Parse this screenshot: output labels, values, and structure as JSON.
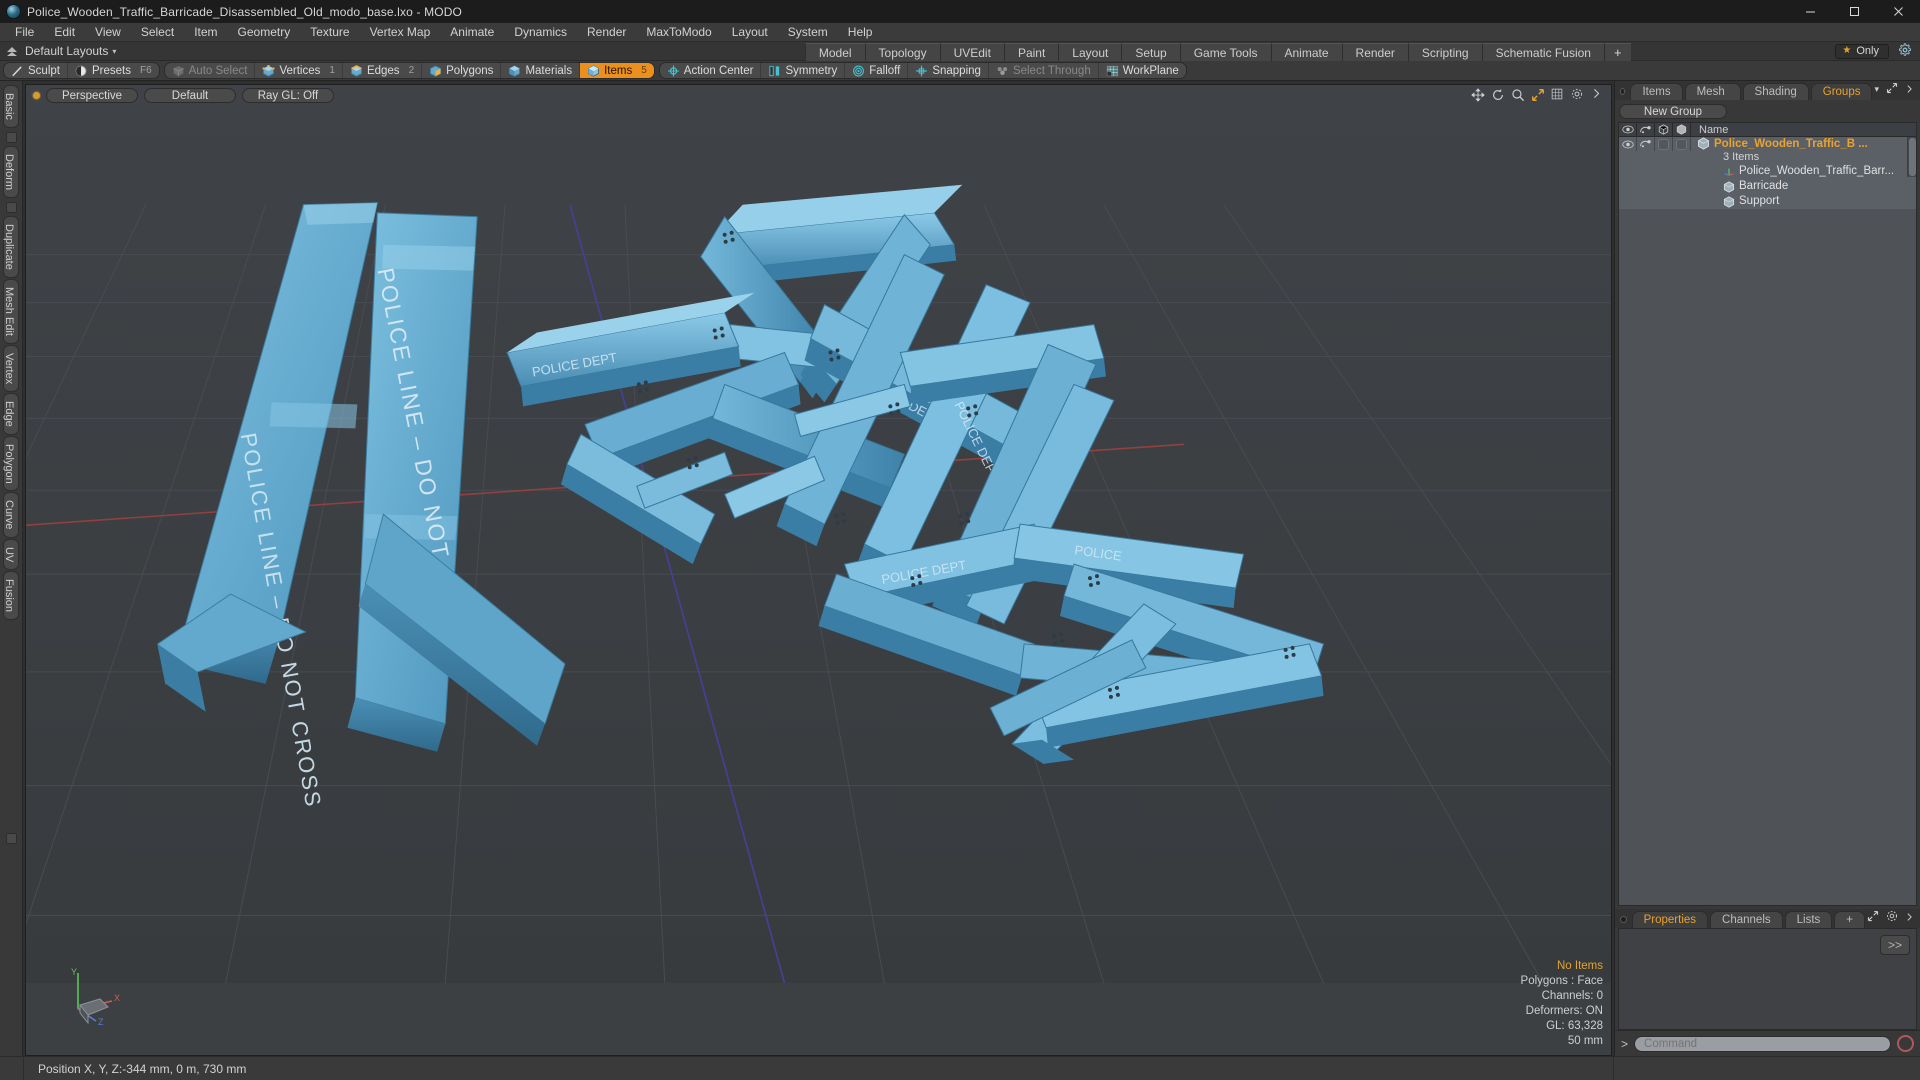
{
  "window": {
    "title": "Police_Wooden_Traffic_Barricade_Disassembled_Old_modo_base.lxo - MODO",
    "app_icon": "modo-sphere-icon",
    "minimize": "minimize-icon",
    "maximize": "maximize-icon",
    "close": "close-icon"
  },
  "menubar": {
    "items": [
      "File",
      "Edit",
      "View",
      "Select",
      "Item",
      "Geometry",
      "Texture",
      "Vertex Map",
      "Animate",
      "Dynamics",
      "Render",
      "MaxToModo",
      "Layout",
      "System",
      "Help"
    ]
  },
  "layoutrow": {
    "default_layouts": "Default Layouts",
    "caret": "▾",
    "tabs": [
      "Model",
      "Topology",
      "UVEdit",
      "Paint",
      "Layout",
      "Setup",
      "Game Tools",
      "Animate",
      "Render",
      "Scripting",
      "Schematic Fusion"
    ],
    "add_tab": "+",
    "only_label": "Only",
    "star_icon": "star-icon",
    "gear_icon": "gear-icon"
  },
  "modebar": {
    "group1": [
      {
        "label": "Sculpt",
        "icon": "sculpt-brush-icon",
        "hint": "",
        "state": "normal"
      },
      {
        "label": "Presets",
        "icon": "presets-sphere-icon",
        "hint": "F6",
        "state": "normal"
      }
    ],
    "group2": [
      {
        "label": "Auto Select",
        "icon": "auto-select-cube-icon",
        "hint": "",
        "state": "dim"
      },
      {
        "label": "Vertices",
        "icon": "vertices-cube-icon",
        "hint": "1",
        "state": "normal"
      },
      {
        "label": "Edges",
        "icon": "edges-cube-icon",
        "hint": "2",
        "state": "normal"
      },
      {
        "label": "Polygons",
        "icon": "polygons-cube-icon",
        "hint": "",
        "state": "normal"
      },
      {
        "label": "Materials",
        "icon": "materials-cube-icon",
        "hint": "",
        "state": "normal"
      },
      {
        "label": "Items",
        "icon": "items-cube-icon",
        "hint": "5",
        "state": "active"
      }
    ],
    "group3": [
      {
        "label": "Action Center",
        "icon": "action-center-icon",
        "state": "normal"
      },
      {
        "label": "Symmetry",
        "icon": "symmetry-icon",
        "state": "normal"
      },
      {
        "label": "Falloff",
        "icon": "falloff-icon",
        "state": "normal"
      },
      {
        "label": "Snapping",
        "icon": "snapping-icon",
        "state": "normal"
      },
      {
        "label": "Select Through",
        "icon": "select-through-icon",
        "state": "dim"
      },
      {
        "label": "WorkPlane",
        "icon": "workplane-icon",
        "state": "normal"
      }
    ]
  },
  "left_tabs": {
    "items": [
      "Basic",
      "Deform",
      "Duplicate",
      "Mesh Edit",
      "Vertex",
      "Edge",
      "Polygon",
      "Curve",
      "UV",
      "Fusion"
    ]
  },
  "viewport": {
    "view_mode": "Perspective",
    "shading": "Default",
    "raygl": "Ray GL: Off",
    "icons": [
      "move-icon",
      "rotate-icon",
      "zoom-icon",
      "fit-icon",
      "grid-icon",
      "settings-icon",
      "expand-icon"
    ],
    "background_color": "#3c4043",
    "model_color": "#5aa8d0",
    "stats": {
      "selection": "No Items",
      "polygons": "Polygons : Face",
      "channels": "Channels: 0",
      "deformers": "Deformers: ON",
      "gl": "GL: 63,328",
      "grid": "50 mm"
    },
    "gizmo": {
      "y": "Y",
      "x": "X",
      "z": "Z"
    }
  },
  "right_panel": {
    "tabs": [
      {
        "label": "Items",
        "selected": false
      },
      {
        "label": "Mesh ...",
        "selected": false
      },
      {
        "label": "Shading",
        "selected": false
      },
      {
        "label": "Groups",
        "selected": true
      }
    ],
    "tab_overflow": "▾",
    "expand_icon": "expand-icon",
    "more_icon": "chevron-right-icon",
    "new_group_button": "New Group",
    "tree_columns": [
      "eye-icon",
      "render-icon",
      "shade-icon",
      "wire-icon"
    ],
    "name_column": "Name",
    "tree": {
      "root": {
        "name": "Police_Wooden_Traffic_B ...",
        "icon": "group-cube-icon",
        "sub": "3 Items",
        "selected": true
      },
      "children": [
        {
          "name": "Police_Wooden_Traffic_Barr...",
          "icon": "locator-axis-icon"
        },
        {
          "name": "Barricade",
          "icon": "mesh-cube-icon"
        },
        {
          "name": "Support",
          "icon": "mesh-cube-icon"
        }
      ]
    },
    "bottom_tabs": [
      {
        "label": "Properties",
        "selected": true
      },
      {
        "label": "Channels",
        "selected": false
      },
      {
        "label": "Lists",
        "selected": false
      },
      {
        "label": "+",
        "selected": false
      }
    ],
    "properties_expand": ">>",
    "command": {
      "prompt": ">",
      "placeholder": "Command",
      "value": "",
      "record_icon": "record-icon"
    }
  },
  "statusbar": {
    "position_label": "Position X, Y, Z:",
    "position_value": "-344 mm, 0 m, 730 mm"
  }
}
